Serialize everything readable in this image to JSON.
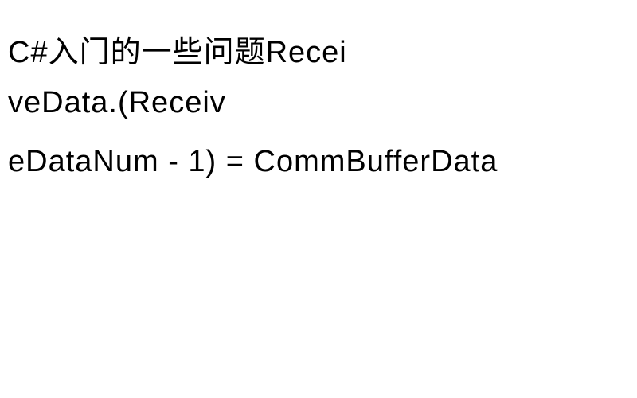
{
  "lines": {
    "l1": "C#入门的一些问题Recei",
    "l2": "veData.(Receiv",
    "l3": "eDataNum - 1) = CommBufferData",
    "l4": ""
  }
}
